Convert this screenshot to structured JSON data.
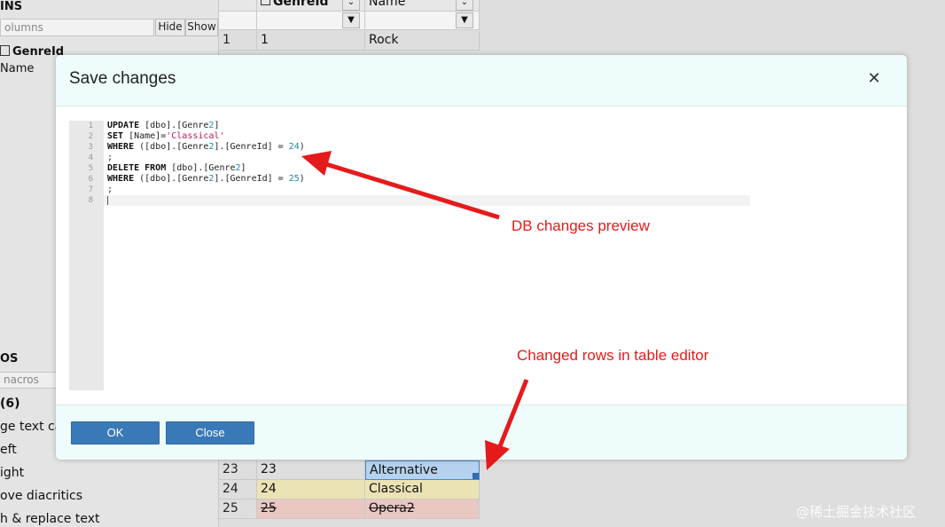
{
  "left_panel": {
    "columns_title": "INS",
    "columns_filter_placeholder": "olumns",
    "hide_label": "Hide",
    "show_label": "Show",
    "columns": [
      {
        "label": "GenreId",
        "icon": "primary-key-icon"
      },
      {
        "label": "Name"
      }
    ],
    "macros_title": "OS",
    "macros_filter_placeholder": "nacros",
    "macro_group": "(6)",
    "macros": [
      "ge text ca",
      "eft",
      "ight",
      "ove diacritics",
      "h & replace text"
    ]
  },
  "grid": {
    "columns": [
      {
        "label": "GenreId",
        "icon": "table-column-icon"
      },
      {
        "label": "Name"
      }
    ],
    "rows": [
      {
        "num": "1",
        "id": "1",
        "name": "Rock",
        "state": "normal"
      },
      {
        "num": "23",
        "id": "23",
        "name": "Alternative",
        "state": "selected"
      },
      {
        "num": "24",
        "id": "24",
        "name": "Classical",
        "state": "modified"
      },
      {
        "num": "25",
        "id": "25",
        "name": "Opera2",
        "state": "deleted"
      }
    ],
    "filter_icon": "funnel-icon",
    "dropdown_icon": "chevron-down-icon"
  },
  "modal": {
    "title": "Save changes",
    "close_icon": "close-icon",
    "line_numbers": [
      "1",
      "2",
      "3",
      "4",
      "5",
      "6",
      "7",
      "8"
    ],
    "ok_label": "OK",
    "close_label": "Close"
  },
  "annotations": {
    "preview": "DB changes preview",
    "rows": "Changed rows in table editor",
    "color": "#e51b1b"
  },
  "watermark": "@稀土掘金技术社区",
  "colors": {
    "button": "#3a79b8",
    "modified_row": "#ece3b5",
    "deleted_row": "#e9c8c2",
    "selected_row": "#b5d2ee"
  }
}
